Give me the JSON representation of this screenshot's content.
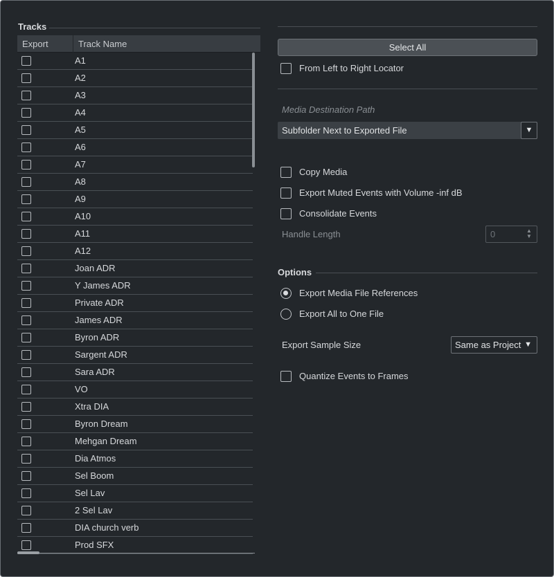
{
  "tracks": {
    "title": "Tracks",
    "columns": {
      "export": "Export",
      "name": "Track Name"
    },
    "rows": [
      {
        "name": "A1",
        "checked": false
      },
      {
        "name": "A2",
        "checked": false
      },
      {
        "name": "A3",
        "checked": false
      },
      {
        "name": "A4",
        "checked": false
      },
      {
        "name": "A5",
        "checked": false
      },
      {
        "name": "A6",
        "checked": false
      },
      {
        "name": "A7",
        "checked": false
      },
      {
        "name": "A8",
        "checked": false
      },
      {
        "name": "A9",
        "checked": false
      },
      {
        "name": "A10",
        "checked": false
      },
      {
        "name": "A11",
        "checked": false
      },
      {
        "name": "A12",
        "checked": false
      },
      {
        "name": "Joan ADR",
        "checked": false
      },
      {
        "name": "Y James ADR",
        "checked": false
      },
      {
        "name": "Private ADR",
        "checked": false
      },
      {
        "name": "James ADR",
        "checked": false
      },
      {
        "name": "Byron ADR",
        "checked": false
      },
      {
        "name": "Sargent ADR",
        "checked": false
      },
      {
        "name": "Sara ADR",
        "checked": false
      },
      {
        "name": "VO",
        "checked": false
      },
      {
        "name": "Xtra DIA",
        "checked": false
      },
      {
        "name": "Byron Dream",
        "checked": false
      },
      {
        "name": "Mehgan Dream",
        "checked": false
      },
      {
        "name": "Dia Atmos",
        "checked": false
      },
      {
        "name": "Sel Boom",
        "checked": false
      },
      {
        "name": "Sel Lav",
        "checked": false
      },
      {
        "name": "2 Sel Lav",
        "checked": false
      },
      {
        "name": "DIA church verb",
        "checked": false
      },
      {
        "name": "Prod SFX",
        "checked": false
      }
    ]
  },
  "selection": {
    "select_all_label": "Select All",
    "from_left_to_right_locator": {
      "label": "From Left to Right Locator",
      "checked": false
    }
  },
  "media": {
    "destination_path_label": "Media Destination Path",
    "destination_value": "Subfolder Next to Exported File",
    "dropdown_arrow": "▼",
    "copy_media": {
      "label": "Copy Media",
      "checked": false
    },
    "export_muted": {
      "label": "Export Muted Events with Volume -inf dB",
      "checked": false
    },
    "consolidate": {
      "label": "Consolidate Events",
      "checked": false
    },
    "handle_length_label": "Handle Length",
    "handle_length_value": "0"
  },
  "options": {
    "title": "Options",
    "radio_references": {
      "label": "Export Media File References",
      "selected": true
    },
    "radio_one_file": {
      "label": "Export All to One File",
      "selected": false
    },
    "sample_size_label": "Export Sample Size",
    "sample_size_value": "Same as Project",
    "sample_size_arrow": "▼",
    "quantize": {
      "label": "Quantize Events to Frames",
      "checked": false
    }
  }
}
